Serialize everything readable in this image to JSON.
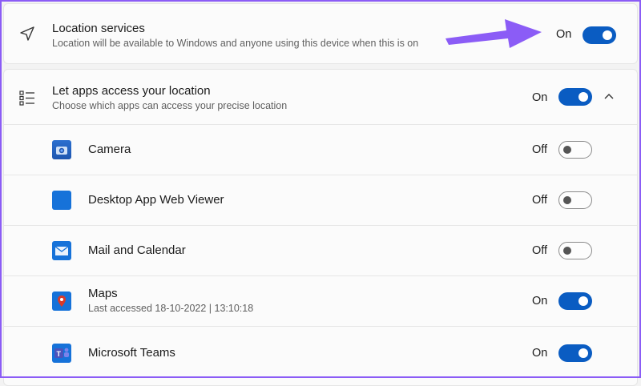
{
  "location_services": {
    "title": "Location services",
    "description": "Location will be available to Windows and anyone using this device when this is on",
    "state": "On"
  },
  "app_access": {
    "title": "Let apps access your location",
    "description": "Choose which apps can access your precise location",
    "state": "On"
  },
  "apps": [
    {
      "name": "Camera",
      "detail": "",
      "state": "Off",
      "icon": "camera-app-icon"
    },
    {
      "name": "Desktop App Web Viewer",
      "detail": "",
      "state": "Off",
      "icon": "web-viewer-app-icon"
    },
    {
      "name": "Mail and Calendar",
      "detail": "",
      "state": "Off",
      "icon": "mail-app-icon"
    },
    {
      "name": "Maps",
      "detail": "Last accessed 18-10-2022  |  13:10:18",
      "state": "On",
      "icon": "maps-app-icon"
    },
    {
      "name": "Microsoft Teams",
      "detail": "",
      "state": "On",
      "icon": "teams-app-icon"
    }
  ],
  "colors": {
    "accent": "#0a5cc2",
    "annotation_arrow": "#8b5cf6",
    "border": "#8b5cf6"
  }
}
